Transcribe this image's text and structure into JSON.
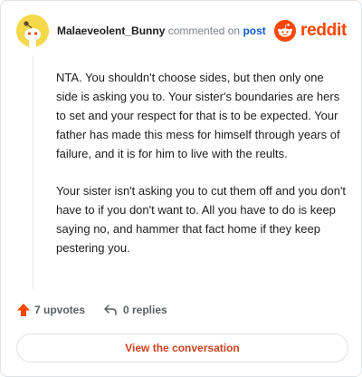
{
  "header": {
    "username": "Malaeveolent_Bunny",
    "commented_text": "commented on",
    "post_link": "post",
    "brand": "reddit"
  },
  "comment": {
    "paragraphs": [
      "NTA. You shouldn't choose sides, but then only one side is asking you to. Your sister's boundaries are hers to set and your respect for that is to be expected. Your father has made this mess for himself through years of failure, and it is for him to live with the reults.",
      "Your sister isn't asking you to cut them off and you don't have to if you don't want to. All you have to do is keep saying no, and hammer that fact home if they keep pestering you."
    ]
  },
  "footer": {
    "upvotes": "7 upvotes",
    "replies": "0 replies"
  },
  "cta": {
    "label": "View the conversation"
  },
  "colors": {
    "accent": "#ff4500",
    "link": "#0b5cd7",
    "cta_text": "#d0411f"
  }
}
